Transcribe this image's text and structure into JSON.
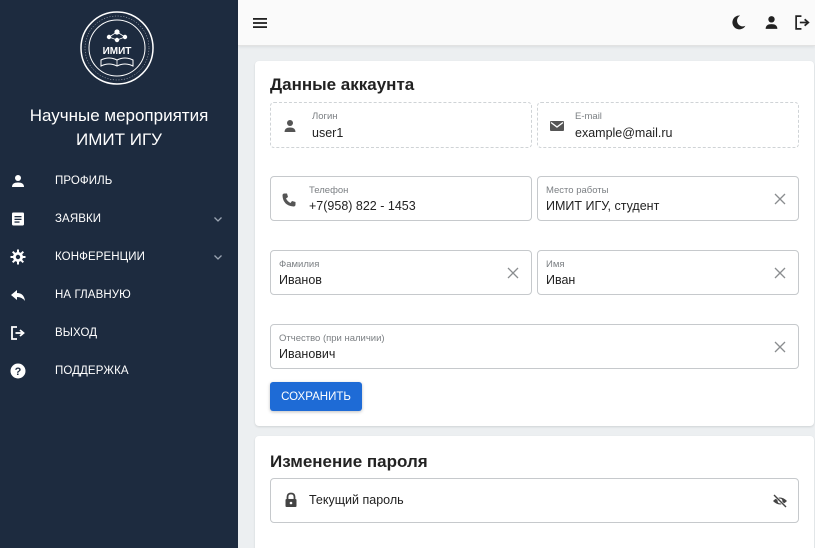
{
  "sidebar": {
    "logo_text": "ИМИТ",
    "title_line1": "Научные мероприятия",
    "title_line2": "ИМИТ ИГУ",
    "items": [
      {
        "label": "Профиль",
        "icon": "person-icon"
      },
      {
        "label": "Заявки",
        "icon": "document-icon",
        "expandable": true
      },
      {
        "label": "Конференции",
        "icon": "gear-icon",
        "expandable": true
      },
      {
        "label": "На главную",
        "icon": "reply-arrow-icon"
      },
      {
        "label": "Выход",
        "icon": "logout-icon"
      },
      {
        "label": "Поддержка",
        "icon": "help-circle-icon"
      }
    ]
  },
  "topbar": {
    "icons": [
      "menu-icon",
      "dark-mode-moon-icon",
      "account-icon",
      "logout-icon"
    ]
  },
  "account": {
    "title": "Данные аккаунта",
    "login": {
      "label": "Логин",
      "value": "user1"
    },
    "email": {
      "label": "E-mail",
      "value": "example@mail.ru"
    },
    "phone": {
      "label": "Телефон",
      "value": "+7(958) 822 - 1453"
    },
    "workplace": {
      "label": "Место работы",
      "value": "ИМИТ ИГУ, студент"
    },
    "surname": {
      "label": "Фамилия",
      "value": "Иванов"
    },
    "name": {
      "label": "Имя",
      "value": "Иван"
    },
    "patronymic": {
      "label": "Отчество (при наличии)",
      "value": "Иванович"
    },
    "save_label": "Сохранить"
  },
  "password": {
    "title": "Изменение пароля",
    "current_placeholder": "Текущий пароль"
  },
  "colors": {
    "sidebar_bg": "#1d2b3f",
    "accent": "#1e6bd6",
    "page_bg": "#eceff1"
  }
}
